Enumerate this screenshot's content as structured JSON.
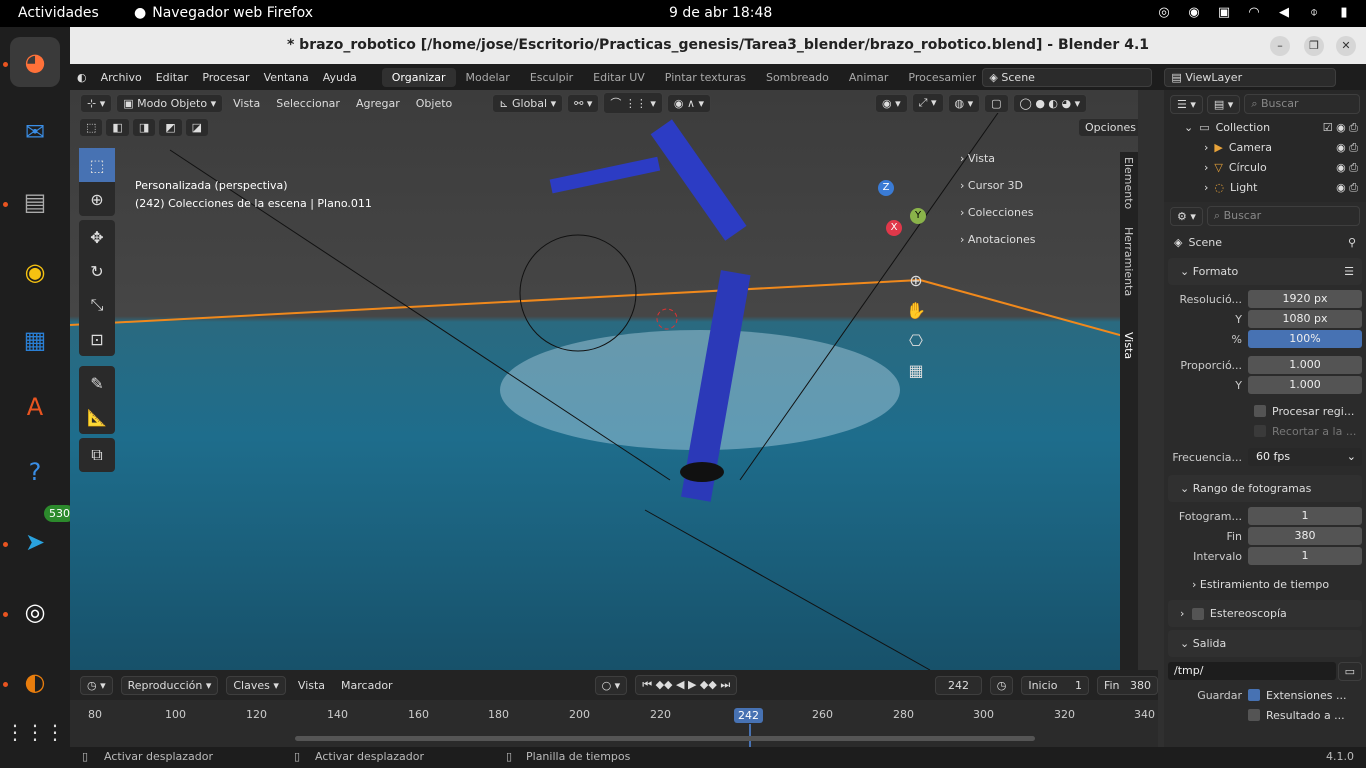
{
  "topbar": {
    "activities": "Actividades",
    "app_name": "Navegador web Firefox",
    "clock": "9 de abr  18:48"
  },
  "dock": {
    "telegram_badge": "530"
  },
  "window": {
    "title": "* brazo_robotico [/home/jose/Escritorio/Practicas_genesis/Tarea3_blender/brazo_robotico.blend] - Blender 4.1"
  },
  "menubar": {
    "menus": [
      "Archivo",
      "Editar",
      "Procesar",
      "Ventana",
      "Ayuda"
    ],
    "workspaces": [
      "Organizar",
      "Modelar",
      "Esculpir",
      "Editar UV",
      "Pintar texturas",
      "Sombreado",
      "Animar",
      "Procesamiento"
    ],
    "scene": "Scene",
    "view_layer": "ViewLayer"
  },
  "viewport": {
    "mode": "Modo Objeto",
    "menus": [
      "Vista",
      "Seleccionar",
      "Agregar",
      "Objeto"
    ],
    "transform": "Global",
    "options": "Opciones",
    "overlay_line1": "Personalizada (perspectiva)",
    "overlay_line2": "(242) Colecciones de la escena | Plano.011",
    "npanel_rows": [
      "Vista",
      "Cursor 3D",
      "Colecciones",
      "Anotaciones"
    ],
    "side_tabs": [
      "Elemento",
      "Herramienta",
      "Vista"
    ]
  },
  "outliner": {
    "search_placeholder": "Buscar",
    "items": [
      "Collection",
      "Camera",
      "Círculo",
      "Light"
    ]
  },
  "properties": {
    "search_placeholder": "Buscar",
    "scene": "Scene",
    "formato": "Formato",
    "res_label": "Resolució...",
    "res_x": "1920 px",
    "res_y": "1080 px",
    "res_pct": "100%",
    "y_label": "Y",
    "pct_label": "%",
    "aspect_label": "Proporció...",
    "aspect_x": "1.000",
    "aspect_y": "1.000",
    "procesar_region": "Procesar regi...",
    "recortar": "Recortar a la ...",
    "fps_label": "Frecuencia...",
    "fps": "60 fps",
    "rango": "Rango de fotogramas",
    "start_label": "Fotogram...",
    "start": "1",
    "end_label": "Fin",
    "end": "380",
    "step_label": "Intervalo",
    "step": "1",
    "time_stretch": "Estiramiento de tiempo",
    "stereo": "Estereoscopía",
    "salida": "Salida",
    "path": "/tmp/",
    "guardar": "Guardar",
    "extensiones": "Extensiones ...",
    "resultado": "Resultado a ..."
  },
  "timeline": {
    "menus": [
      "Reproducción",
      "Claves",
      "Vista",
      "Marcador"
    ],
    "current": "242",
    "inicio_label": "Inicio",
    "inicio": "1",
    "fin_label": "Fin",
    "fin": "380",
    "ticks": [
      "80",
      "100",
      "120",
      "140",
      "160",
      "180",
      "200",
      "220",
      "242",
      "260",
      "280",
      "300",
      "320",
      "340"
    ]
  },
  "statusbar": {
    "items": [
      "Activar desplazador",
      "Activar desplazador",
      "Planilla de tiempos"
    ],
    "version": "4.1.0"
  }
}
